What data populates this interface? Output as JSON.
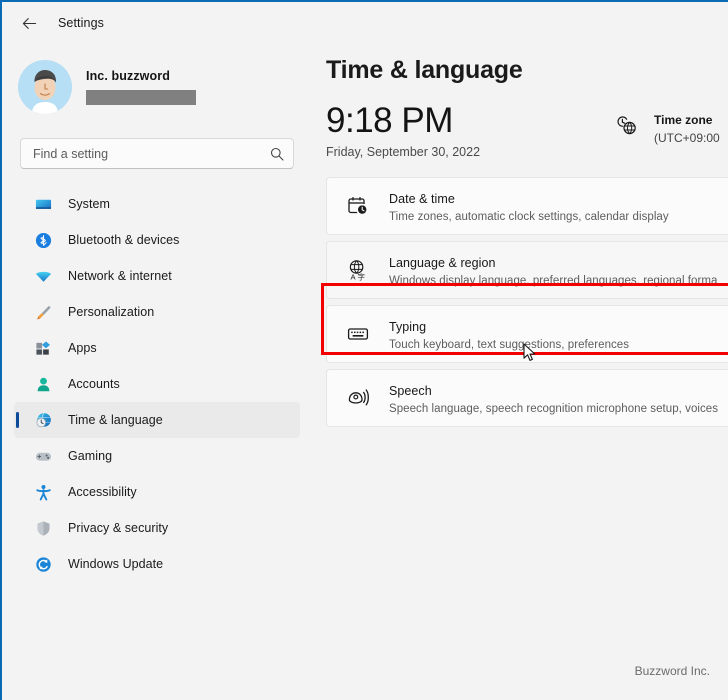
{
  "window": {
    "border_color": "#0a6ab4",
    "background": "#f3f3f3"
  },
  "titlebar": {
    "back_label": "back-arrow",
    "title": "Settings"
  },
  "account": {
    "name": "Inc. buzzword",
    "email_redacted": true,
    "avatar": "user-avatar-illustration"
  },
  "search": {
    "placeholder": "Find a setting",
    "value": "",
    "icon": "search-icon"
  },
  "sidebar": {
    "items": [
      {
        "label": "System",
        "icon": "monitor-icon",
        "selected": false
      },
      {
        "label": "Bluetooth & devices",
        "icon": "bluetooth-icon",
        "selected": false
      },
      {
        "label": "Network & internet",
        "icon": "wifi-icon",
        "selected": false
      },
      {
        "label": "Personalization",
        "icon": "paintbrush-icon",
        "selected": false
      },
      {
        "label": "Apps",
        "icon": "apps-icon",
        "selected": false
      },
      {
        "label": "Accounts",
        "icon": "person-icon",
        "selected": false
      },
      {
        "label": "Time & language",
        "icon": "globe-clock-icon",
        "selected": true
      },
      {
        "label": "Gaming",
        "icon": "gamepad-icon",
        "selected": false
      },
      {
        "label": "Accessibility",
        "icon": "accessibility-icon",
        "selected": false
      },
      {
        "label": "Privacy & security",
        "icon": "shield-icon",
        "selected": false
      },
      {
        "label": "Windows Update",
        "icon": "update-icon",
        "selected": false
      }
    ],
    "accent_color": "#0f4b9b",
    "selected_background": "#eaeaea"
  },
  "main": {
    "page_title": "Time & language",
    "clock": {
      "time": "9:18 PM",
      "date": "Friday, September 30, 2022"
    },
    "timezone": {
      "icon": "globe-clock-icon",
      "label": "Time zone",
      "value": "(UTC+09:00"
    },
    "cards": [
      {
        "title": "Date & time",
        "subtitle": "Time zones, automatic clock settings, calendar display",
        "icon": "calendar-clock-icon",
        "highlighted": false
      },
      {
        "title": "Language & region",
        "subtitle": "Windows display language, preferred languages, regional forma",
        "icon": "globe-language-icon",
        "highlighted": true
      },
      {
        "title": "Typing",
        "subtitle": "Touch keyboard, text suggestions, preferences",
        "icon": "keyboard-icon",
        "highlighted": false
      },
      {
        "title": "Speech",
        "subtitle": "Speech language, speech recognition microphone setup, voices",
        "icon": "speech-icon",
        "highlighted": false
      }
    ]
  },
  "annotation": {
    "highlight_color": "#f20000",
    "target": "Language & region"
  },
  "footer": {
    "text": "Buzzword Inc."
  }
}
